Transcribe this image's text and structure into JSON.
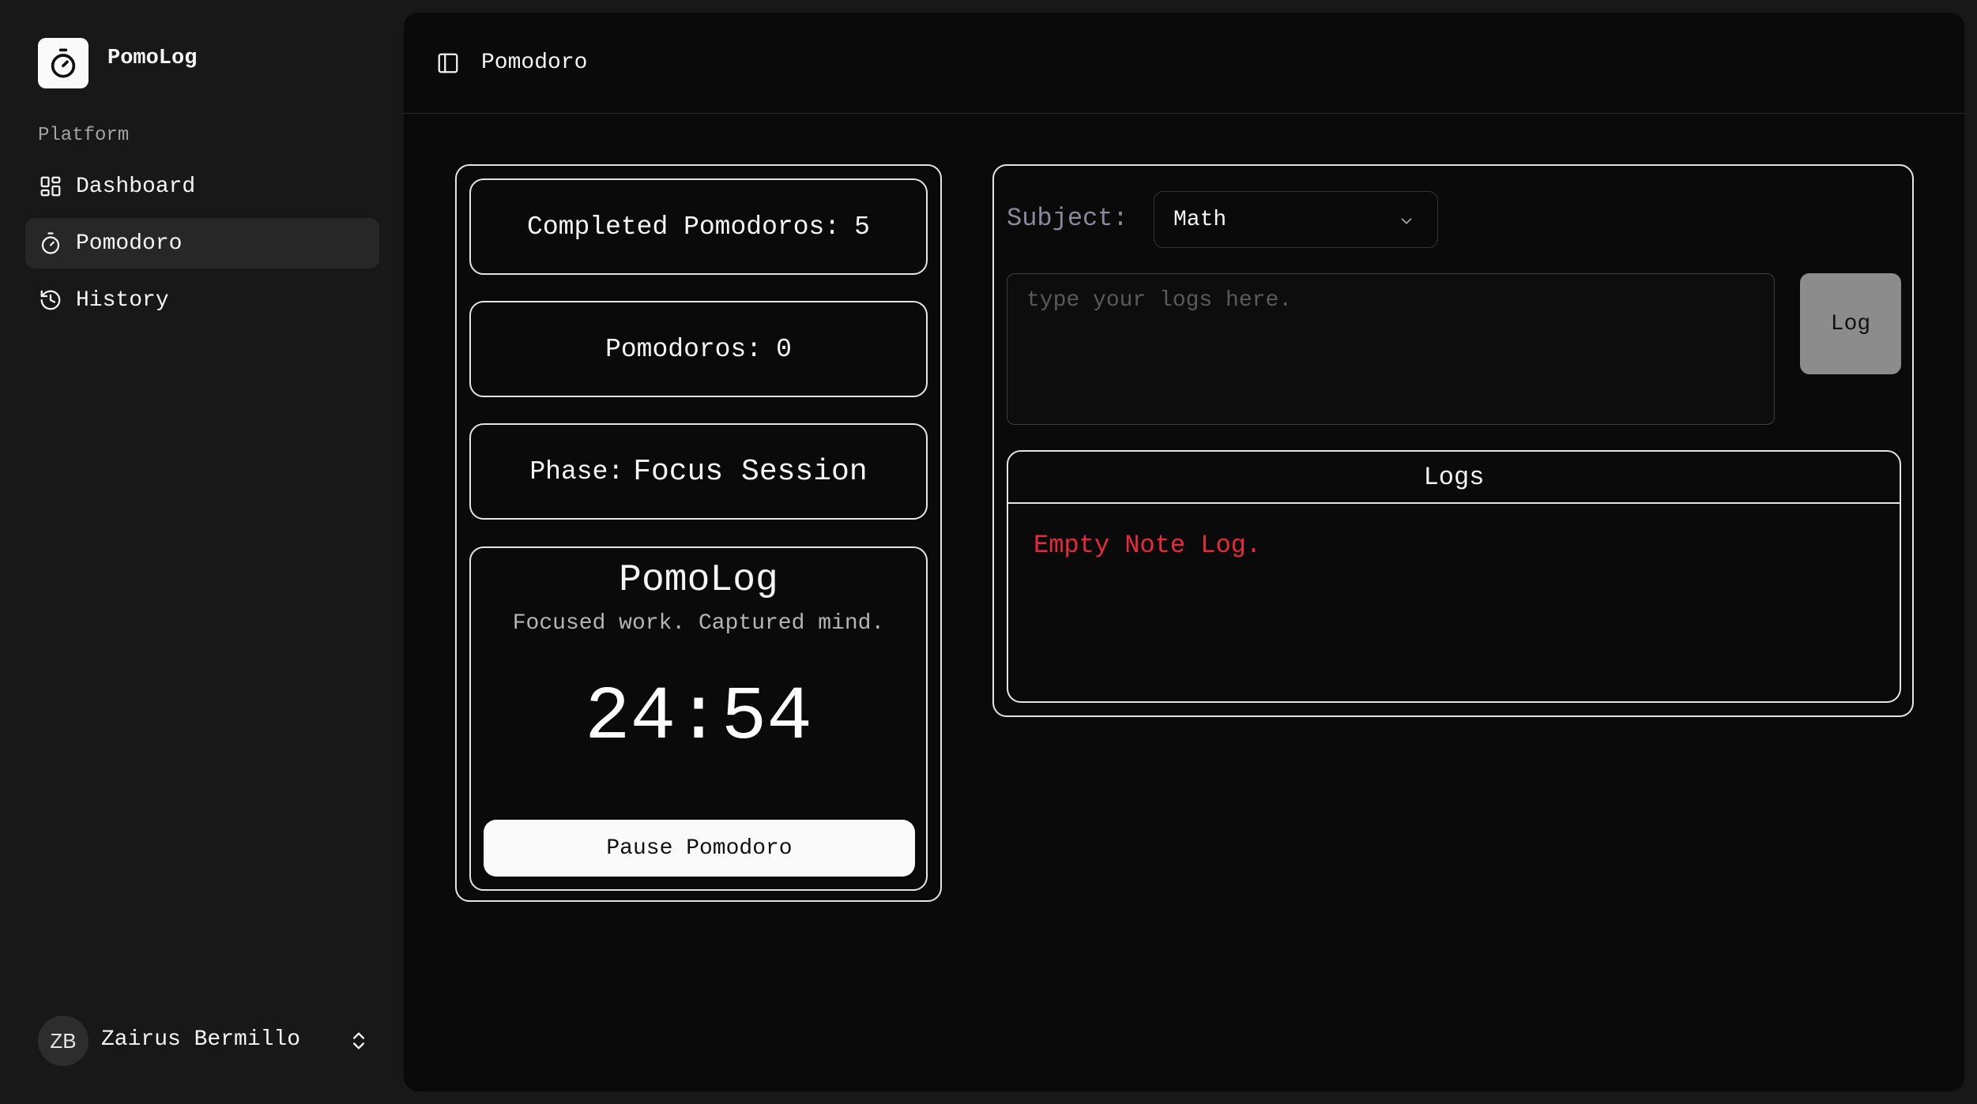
{
  "app": {
    "name": "PomoLog",
    "logo_icon": "stopwatch-icon"
  },
  "sidebar": {
    "section_label": "Platform",
    "items": [
      {
        "label": "Dashboard",
        "icon": "grid-icon",
        "active": false
      },
      {
        "label": "Pomodoro",
        "icon": "stopwatch-icon",
        "active": true
      },
      {
        "label": "History",
        "icon": "history-icon",
        "active": false
      }
    ],
    "user": {
      "initials": "ZB",
      "name": "Zairus Bermillo",
      "menu_icon": "chevrons-up-down-icon"
    }
  },
  "header": {
    "toggle_icon": "sidebar-toggle-icon",
    "title": "Pomodoro"
  },
  "stats": {
    "completed_label": "Completed Pomodoros:",
    "completed_value": "5",
    "pomodoros_label": "Pomodoros:",
    "pomodoros_value": "0",
    "phase_label": "Phase:",
    "phase_value": "Focus Session"
  },
  "timer": {
    "title": "PomoLog",
    "tagline": "Focused work. Captured mind.",
    "time": "24:54",
    "pause_label": "Pause Pomodoro"
  },
  "log_form": {
    "subject_label": "Subject:",
    "subject_value": "Math",
    "placeholder": "type your logs here.",
    "submit_label": "Log"
  },
  "logs": {
    "header": "Logs",
    "empty_message": "Empty Note Log."
  },
  "colors": {
    "background": "#181818",
    "panel": "#0a0a0a",
    "border": "#e5e5e5",
    "active_nav": "#272727",
    "empty_text": "#e8293b",
    "log_button": "#8c8c8c"
  }
}
